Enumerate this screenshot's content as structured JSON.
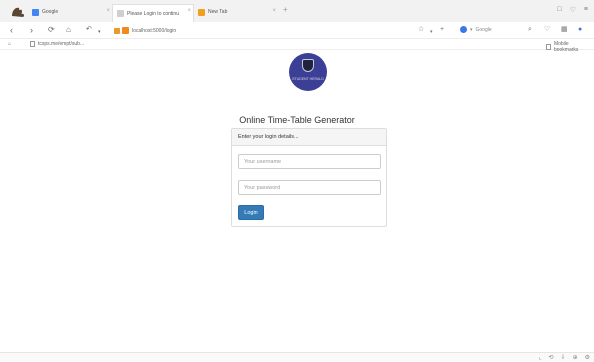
{
  "tabs": [
    {
      "label": "Google",
      "favicon_color": "#4285f4"
    },
    {
      "label": "Please Login to continu",
      "favicon_color": "#cfcfcf"
    },
    {
      "label": "New Tab",
      "favicon_color": "#f0a020"
    }
  ],
  "new_tab_symbol": "+",
  "window_controls": [
    "□",
    "♡",
    "≡"
  ],
  "address_bar": {
    "url": "localhost:5000/login"
  },
  "search_engine": {
    "label": "Google"
  },
  "bookmarks": [
    {
      "label": "tcsps.me/empt/sub..."
    }
  ],
  "bookmarks_right": {
    "label": "Mobile bookmarks"
  },
  "logo": {
    "text": "STUDENT HERALD"
  },
  "page": {
    "title": "Online Time-Table Generator"
  },
  "login_form": {
    "heading": "Enter your login details...",
    "username_placeholder": "Your username",
    "password_placeholder": "Your password",
    "submit_label": "Login"
  },
  "colors": {
    "primary_button": "#337ab7",
    "logo_bg": "#3b3f96"
  }
}
